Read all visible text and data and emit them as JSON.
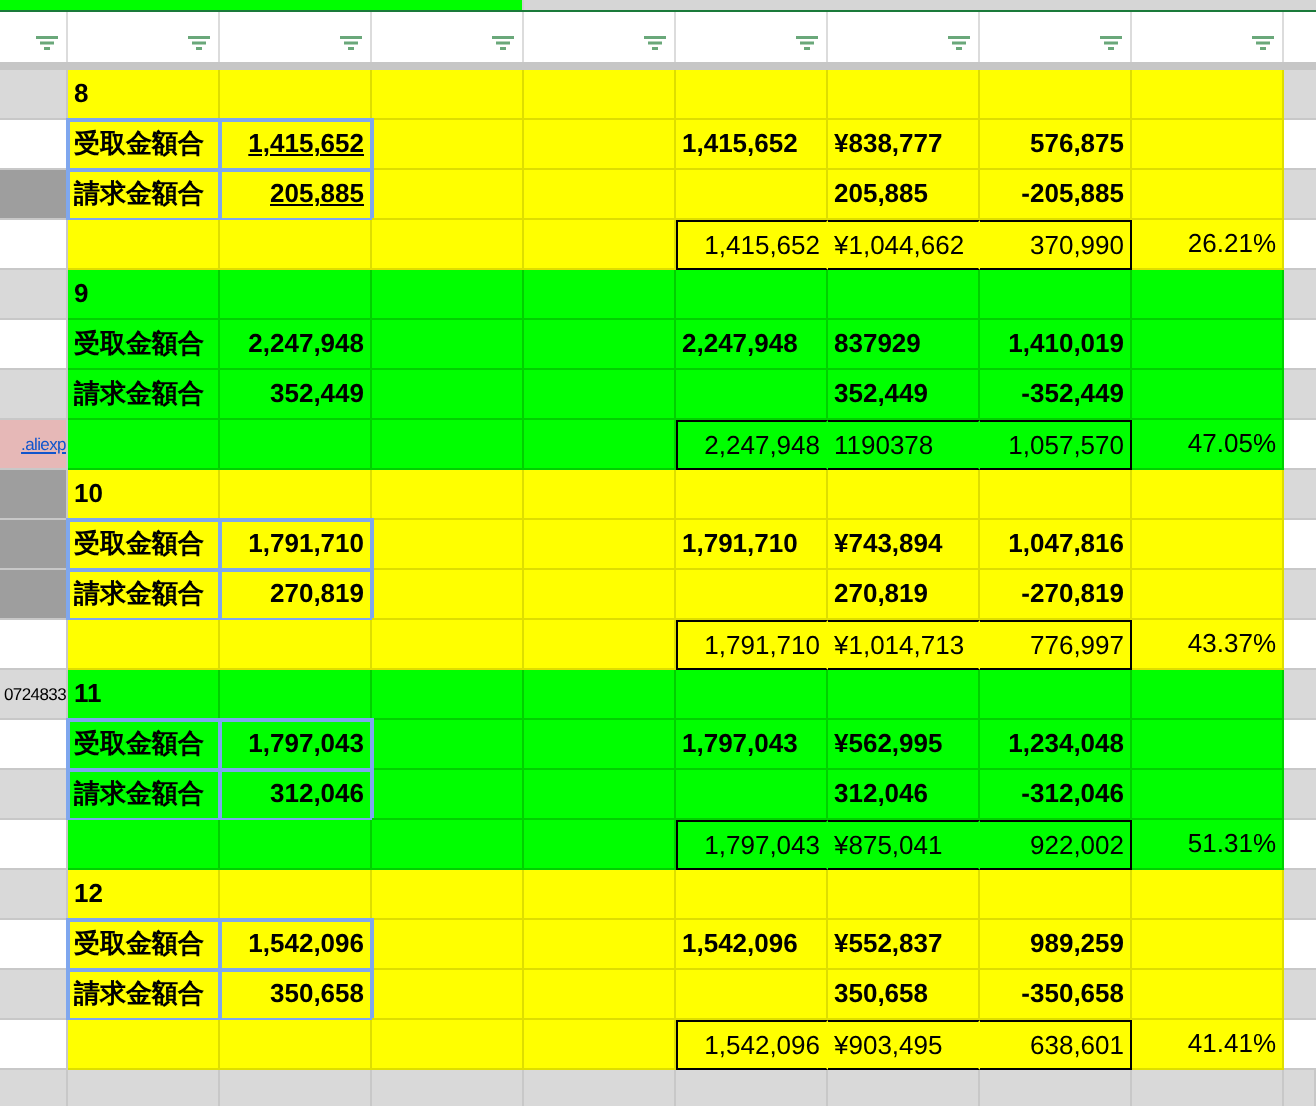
{
  "blocks": [
    {
      "color": "#ffff00",
      "month": "8",
      "outlined": true,
      "underline": true,
      "side": [
        {
          "color": "#d9d9d9"
        },
        {
          "color": "#ffffff"
        },
        {
          "color": "#9e9e9e"
        },
        {
          "color": "#ffffff"
        }
      ],
      "received": {
        "label": "受取金額合",
        "value": "1,415,652",
        "f": "1,415,652",
        "g": "¥838,777",
        "h": "576,875"
      },
      "billed": {
        "label": "請求金額合",
        "value": "205,885",
        "g": "205,885",
        "h": "-205,885"
      },
      "total": {
        "f": "1,415,652",
        "g": "¥1,044,662",
        "h": "370,990",
        "i": "26.21%"
      }
    },
    {
      "color": "#00ff00",
      "month": "9",
      "outlined": false,
      "underline": false,
      "side": [
        {
          "color": "#d9d9d9"
        },
        {
          "color": "#ffffff"
        },
        {
          "color": "#d9d9d9"
        },
        {
          "color": "#e6b8b7",
          "text": ".aliexp",
          "kind": "link"
        }
      ],
      "received": {
        "label": "受取金額合",
        "value": "2,247,948",
        "f": "2,247,948",
        "g": "837929",
        "h": "1,410,019"
      },
      "billed": {
        "label": "請求金額合",
        "value": "352,449",
        "g": "352,449",
        "h": "-352,449"
      },
      "total": {
        "f": "2,247,948",
        "g": "1190378",
        "h": "1,057,570",
        "i": "47.05%"
      }
    },
    {
      "color": "#ffff00",
      "month": "10",
      "outlined": true,
      "underline": false,
      "side": [
        {
          "color": "#9e9e9e"
        },
        {
          "color": "#9e9e9e"
        },
        {
          "color": "#9e9e9e"
        },
        {
          "color": "#ffffff"
        }
      ],
      "received": {
        "label": "受取金額合",
        "value": "1,791,710",
        "f": "1,791,710",
        "g": "¥743,894",
        "h": "1,047,816"
      },
      "billed": {
        "label": "請求金額合",
        "value": "270,819",
        "g": "270,819",
        "h": "-270,819"
      },
      "total": {
        "f": "1,791,710",
        "g": "¥1,014,713",
        "h": "776,997",
        "i": "43.37%"
      }
    },
    {
      "color": "#00ff00",
      "month": "11",
      "outlined": true,
      "underline": false,
      "side": [
        {
          "color": "#d9d9d9",
          "text": "0724833",
          "kind": "text"
        },
        {
          "color": "#ffffff"
        },
        {
          "color": "#d9d9d9"
        },
        {
          "color": "#ffffff"
        }
      ],
      "received": {
        "label": "受取金額合",
        "value": "1,797,043",
        "f": "1,797,043",
        "g": "¥562,995",
        "h": "1,234,048"
      },
      "billed": {
        "label": "請求金額合",
        "value": "312,046",
        "g": "312,046",
        "h": "-312,046"
      },
      "total": {
        "f": "1,797,043",
        "g": "¥875,041",
        "h": "922,002",
        "i": "51.31%"
      }
    },
    {
      "color": "#ffff00",
      "month": "12",
      "outlined": true,
      "underline": false,
      "side": [
        {
          "color": "#d9d9d9"
        },
        {
          "color": "#ffffff"
        },
        {
          "color": "#d9d9d9"
        },
        {
          "color": "#ffffff"
        }
      ],
      "received": {
        "label": "受取金額合",
        "value": "1,542,096",
        "f": "1,542,096",
        "g": "¥552,837",
        "h": "989,259"
      },
      "billed": {
        "label": "請求金額合",
        "value": "350,658",
        "g": "350,658",
        "h": "-350,658"
      },
      "total": {
        "f": "1,542,096",
        "g": "¥903,495",
        "h": "638,601",
        "i": "41.41%"
      }
    }
  ]
}
